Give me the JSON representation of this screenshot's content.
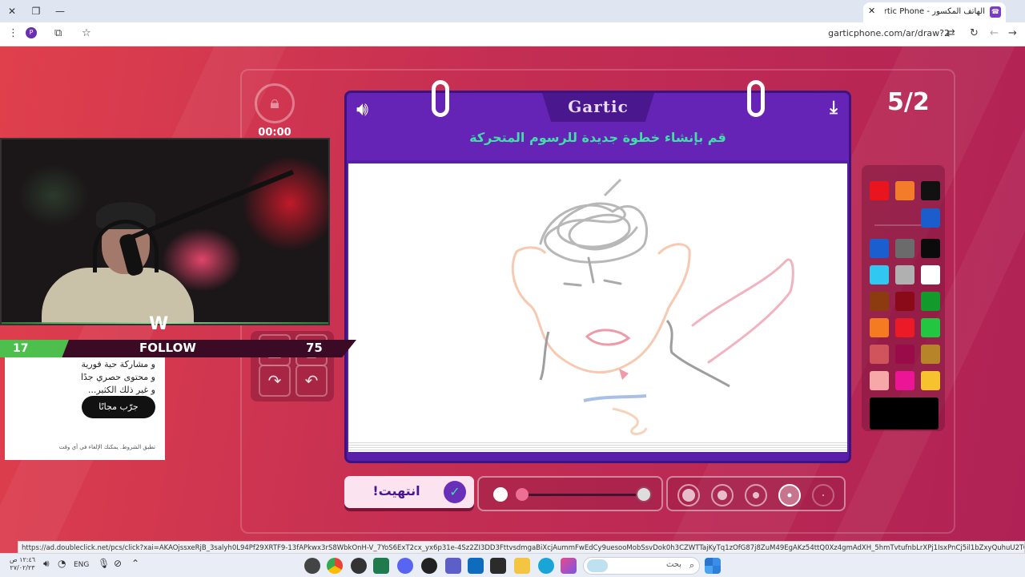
{
  "browser": {
    "tab_title": "الهاتف المكسور - Gartic Phone",
    "tab_close_icon": "✕",
    "newtab_icon": "+",
    "url": "garticphone.com/ar/draw?2",
    "profile_initial": "P"
  },
  "game": {
    "brand": "Gartic",
    "instruction": "قم بإنشاء خطوة جديدة للرسوم المتحركة",
    "timer": "00:00",
    "counter": "5/2",
    "done_label": "انتهيت!"
  },
  "palette": {
    "top_colors": [
      "#e8141e",
      "#f37c2b",
      "#111111",
      "#1c5dcc"
    ],
    "grid_colors": [
      "#1b5ecf",
      "#6b6b6b",
      "#0b0b0b",
      "#30c8f0",
      "#b0b0b0",
      "#ffffff",
      "#8c3b10",
      "#8a0a1a",
      "#129a2c",
      "#f57b22",
      "#ea1a26",
      "#22c640",
      "#d0545b",
      "#9a0b4a",
      "#b8842a",
      "#f6a7a8",
      "#ec1596",
      "#f6c22e"
    ],
    "current_color": "#000000"
  },
  "overlay": {
    "follow_count": "17",
    "follow_label": "FOLLOW",
    "follow_number": "75"
  },
  "ad": {
    "line1": "و مشاركة حية فورية",
    "line2": "و محتوى حصري جدًا",
    "line3": "و غير ذلك الكثير...",
    "button": "جرّب مجانًا",
    "fine_print": "تطبق الشروط. يمكنك الإلغاء في أي وقت"
  },
  "status_link": "https://ad.doubleclick.net/pcs/click?xai=AKAOjssxeRjB_3salyh0L94Pf29XRTF9-13fAPkwx3rS8WbkOnH-V_7YoS6ExT2cx_yx6p31e-4Sz2ZI3DD3FttvsdmgaBiXcjAummFwEdCy9uesooMobSsvDok0h3CZWTTajKyTq1zOfG87j8ZuM49EgAKz54ttQ0Xz4gmAdXH_5hmTvtufnbLrXPj1IsxPnCj5il1bZxyQuhuU2TCtiBJnP0I1yNbiHPOGfbDEMe2Y_L2hlKyMU8yOfrh97GW3cqp...",
  "taskbar": {
    "search_placeholder": "بحث",
    "lang": "ENG",
    "time": "١٢:٤٦ ص",
    "date": "٢٧/٠٢/٢٣"
  }
}
